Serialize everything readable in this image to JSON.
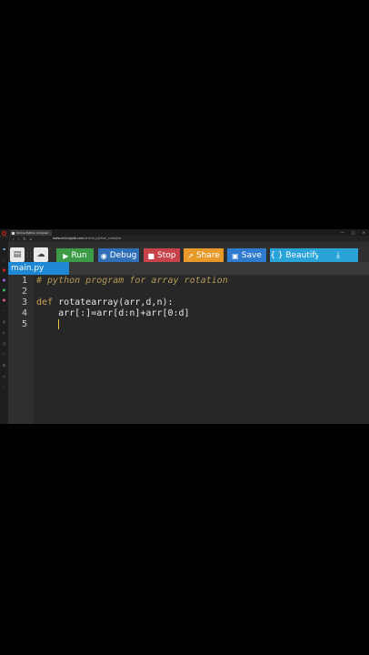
{
  "browser": {
    "tab_title": "Online Python Compiler",
    "url_host": "www.onlinegdb.com",
    "url_path": "/online_python_compiler",
    "window_controls": [
      "—",
      "□",
      "×"
    ]
  },
  "toolbar": {
    "run_label": "Run",
    "debug_label": "Debug",
    "stop_label": "Stop",
    "share_label": "Share",
    "save_label": "Save",
    "beautify_label": "{ } Beautify",
    "colors": {
      "run": "#3d9b48",
      "debug": "#2f70b8",
      "stop": "#c8424a",
      "share": "#e79a29",
      "save": "#2e7bd0",
      "beautify": "#2aa3d8"
    }
  },
  "file": {
    "tab_name": "main.py"
  },
  "editor": {
    "line_numbers": [
      "1",
      "2",
      "3",
      "4",
      "5"
    ],
    "lines": [
      "# python program for array rotation",
      "",
      "def rotatearray(arr,d,n):",
      "    arr[:]=arr[d:n]+arr[0:d]",
      ""
    ],
    "line3_keyword": "def",
    "line3_rest": " rotatearray(arr,d,n):"
  }
}
